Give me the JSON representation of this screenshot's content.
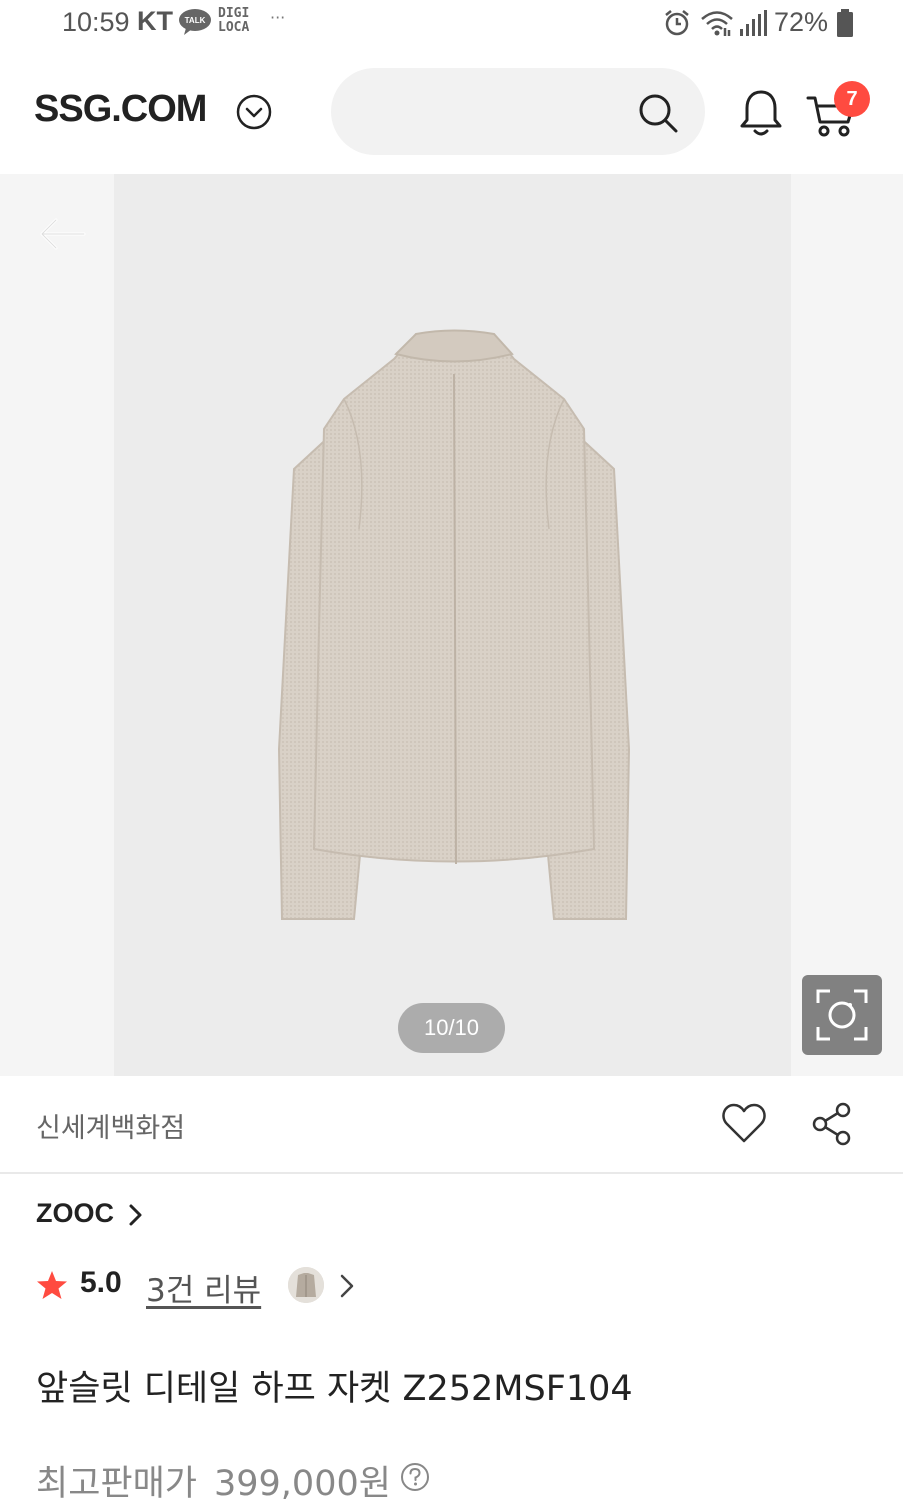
{
  "status_bar": {
    "time": "10:59",
    "carrier": "KT",
    "talk_badge": "TALK",
    "digi_line1": "DIGI",
    "digi_line2": "LOCA",
    "more": "···",
    "battery": "72%"
  },
  "header": {
    "logo": "SSG.COM",
    "search_placeholder": "",
    "cart_count": "7",
    "icons": [
      "chevron-down-icon",
      "search-icon",
      "bell-icon",
      "cart-icon"
    ]
  },
  "gallery": {
    "page_indicator": "10/10",
    "icons": [
      "back-arrow-icon",
      "lens-scan-icon"
    ]
  },
  "product": {
    "store": "신세계백화점",
    "brand": "ZOOC",
    "rating": "5.0",
    "review_link": "3건 리뷰",
    "title": "앞슬릿 디테일 하프 자켓 Z252MSF104",
    "price_label": "최고판매가",
    "price": "399,000원",
    "icons": [
      "heart-icon",
      "share-icon",
      "star-icon",
      "help-icon"
    ]
  },
  "colors": {
    "badge": "#ff4b40",
    "star": "#ff4b40",
    "jacket": "#d8d0c6"
  }
}
